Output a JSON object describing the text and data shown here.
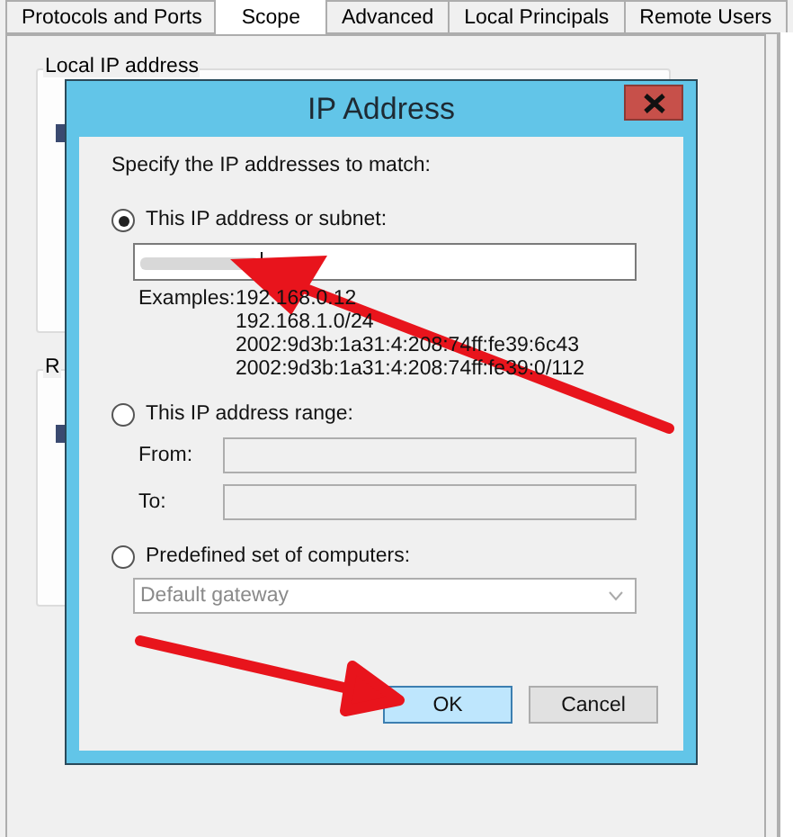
{
  "tabs": [
    {
      "label": "Protocols and Ports",
      "selected": false
    },
    {
      "label": "Scope",
      "selected": true
    },
    {
      "label": "Advanced",
      "selected": false
    },
    {
      "label": "Local Principals",
      "selected": false
    },
    {
      "label": "Remote Users",
      "selected": false
    }
  ],
  "groups": [
    {
      "label": "Local IP address"
    },
    {
      "label": "R"
    }
  ],
  "dialog": {
    "title": "IP Address",
    "prompt": "Specify the IP addresses to match:",
    "options": [
      {
        "kind": "subnet",
        "label": "This IP address or subnet:",
        "selected": true,
        "examples_label": "Examples:",
        "examples": [
          "192.168.0.12",
          "192.168.1.0/24",
          "2002:9d3b:1a31:4:208:74ff:fe39:6c43",
          "2002:9d3b:1a31:4:208:74ff:fe39:0/112"
        ]
      },
      {
        "kind": "range",
        "label": "This IP address range:",
        "selected": false,
        "fields": [
          {
            "label": "From:",
            "disabled": true
          },
          {
            "label": "To:",
            "disabled": true
          }
        ]
      },
      {
        "kind": "predefined",
        "label": "Predefined set of computers:",
        "selected": false,
        "dropdown": {
          "value": "Default gateway",
          "disabled": true
        }
      }
    ],
    "buttons": [
      {
        "label": "OK",
        "default": true
      },
      {
        "label": "Cancel",
        "default": false
      }
    ]
  }
}
